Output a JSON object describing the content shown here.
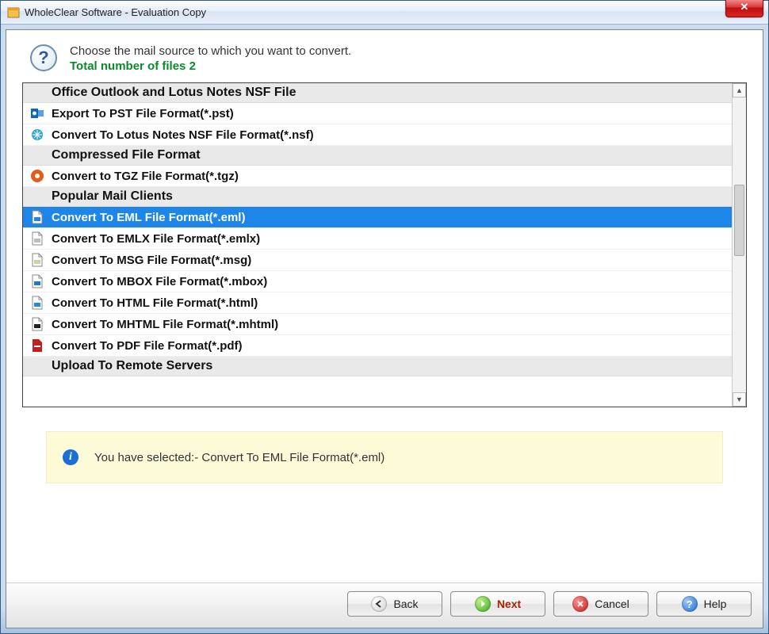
{
  "window": {
    "title": "WholeClear Software - Evaluation Copy"
  },
  "header": {
    "line1": "Choose the mail source to which you want to convert.",
    "line2": "Total number of files 2"
  },
  "list": {
    "groups": [
      {
        "type": "category",
        "label": "Office Outlook and Lotus Notes NSF File"
      },
      {
        "type": "item",
        "icon": "outlook-icon",
        "color": "#0a64c2",
        "label": "Export To PST File Format(*.pst)"
      },
      {
        "type": "item",
        "icon": "lotus-nsf-icon",
        "color": "#2aa7d4",
        "label": "Convert To Lotus Notes NSF File Format(*.nsf)"
      },
      {
        "type": "category",
        "label": "Compressed File Format"
      },
      {
        "type": "item",
        "icon": "tgz-icon",
        "color": "#e85a1a",
        "label": "Convert to TGZ File Format(*.tgz)"
      },
      {
        "type": "category",
        "label": "Popular Mail Clients"
      },
      {
        "type": "item",
        "icon": "eml-icon",
        "color": "#1e86e8",
        "label": "Convert To EML File Format(*.eml)",
        "selected": true
      },
      {
        "type": "item",
        "icon": "emlx-icon",
        "color": "#bdbdbd",
        "label": "Convert To EMLX File Format(*.emlx)"
      },
      {
        "type": "item",
        "icon": "msg-icon",
        "color": "#d0cfa6",
        "label": "Convert To MSG File Format(*.msg)"
      },
      {
        "type": "item",
        "icon": "mbox-icon",
        "color": "#2a74d0",
        "label": "Convert To MBOX File Format(*.mbox)"
      },
      {
        "type": "item",
        "icon": "html-icon",
        "color": "#2a8bd0",
        "label": "Convert To HTML File Format(*.html)"
      },
      {
        "type": "item",
        "icon": "mhtml-icon",
        "color": "#222",
        "label": "Convert To MHTML File Format(*.mhtml)"
      },
      {
        "type": "item",
        "icon": "pdf-icon",
        "color": "#c41e1e",
        "label": "Convert To PDF File Format(*.pdf)"
      },
      {
        "type": "category",
        "label": "Upload To Remote Servers"
      }
    ]
  },
  "info": {
    "prefix": "You have selected:- ",
    "selection": "Convert To EML File Format(*.eml)"
  },
  "buttons": {
    "back": "Back",
    "next": "Next",
    "cancel": "Cancel",
    "help": "Help"
  }
}
